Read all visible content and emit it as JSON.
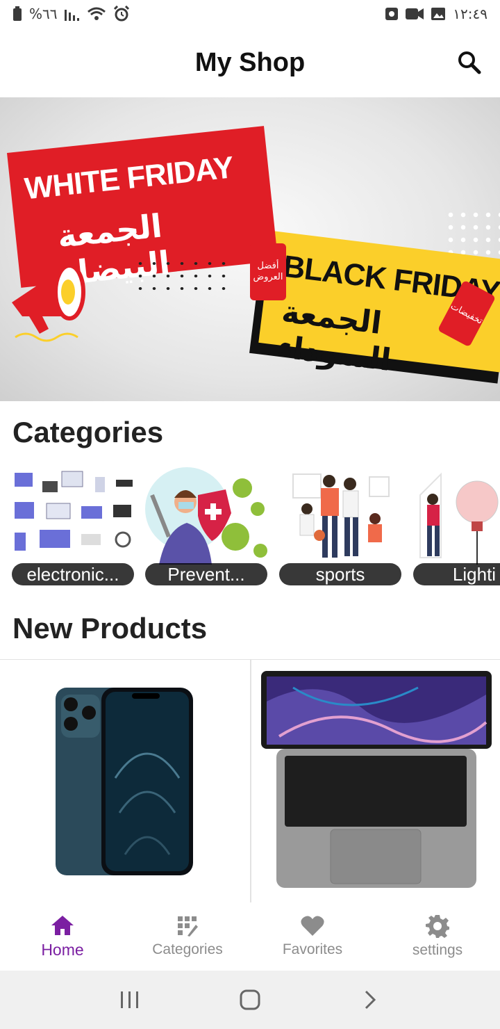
{
  "status_bar": {
    "battery_text": "%٦٦",
    "time": "١٢:٤٩"
  },
  "app_bar": {
    "title": "My Shop"
  },
  "banner": {
    "white_friday_en": "WHITE FRIDAY",
    "white_friday_ar": "الجمعة البيضاء",
    "black_friday_en": "BLACK FRIDAY",
    "black_friday_ar": "الجمعة السوداء",
    "tag_best_offers": "أفضل العروض",
    "tag_discounts": "تخفيضات"
  },
  "sections": {
    "categories_title": "Categories",
    "new_products_title": "New Products"
  },
  "categories": [
    {
      "label": "electronic..."
    },
    {
      "label": "Prevent..."
    },
    {
      "label": "sports"
    },
    {
      "label": "Lighti"
    }
  ],
  "bottom_nav": {
    "items": [
      {
        "label": "Home",
        "icon": "home-icon",
        "active": true
      },
      {
        "label": "Categories",
        "icon": "categories-icon",
        "active": false
      },
      {
        "label": "Favorites",
        "icon": "heart-icon",
        "active": false
      },
      {
        "label": "settings",
        "icon": "gear-icon",
        "active": false
      }
    ]
  },
  "colors": {
    "accent": "#7b1fa2",
    "inactive": "#8c8c8c",
    "banner_red": "#e01e26",
    "banner_yellow": "#fbcf2a"
  }
}
